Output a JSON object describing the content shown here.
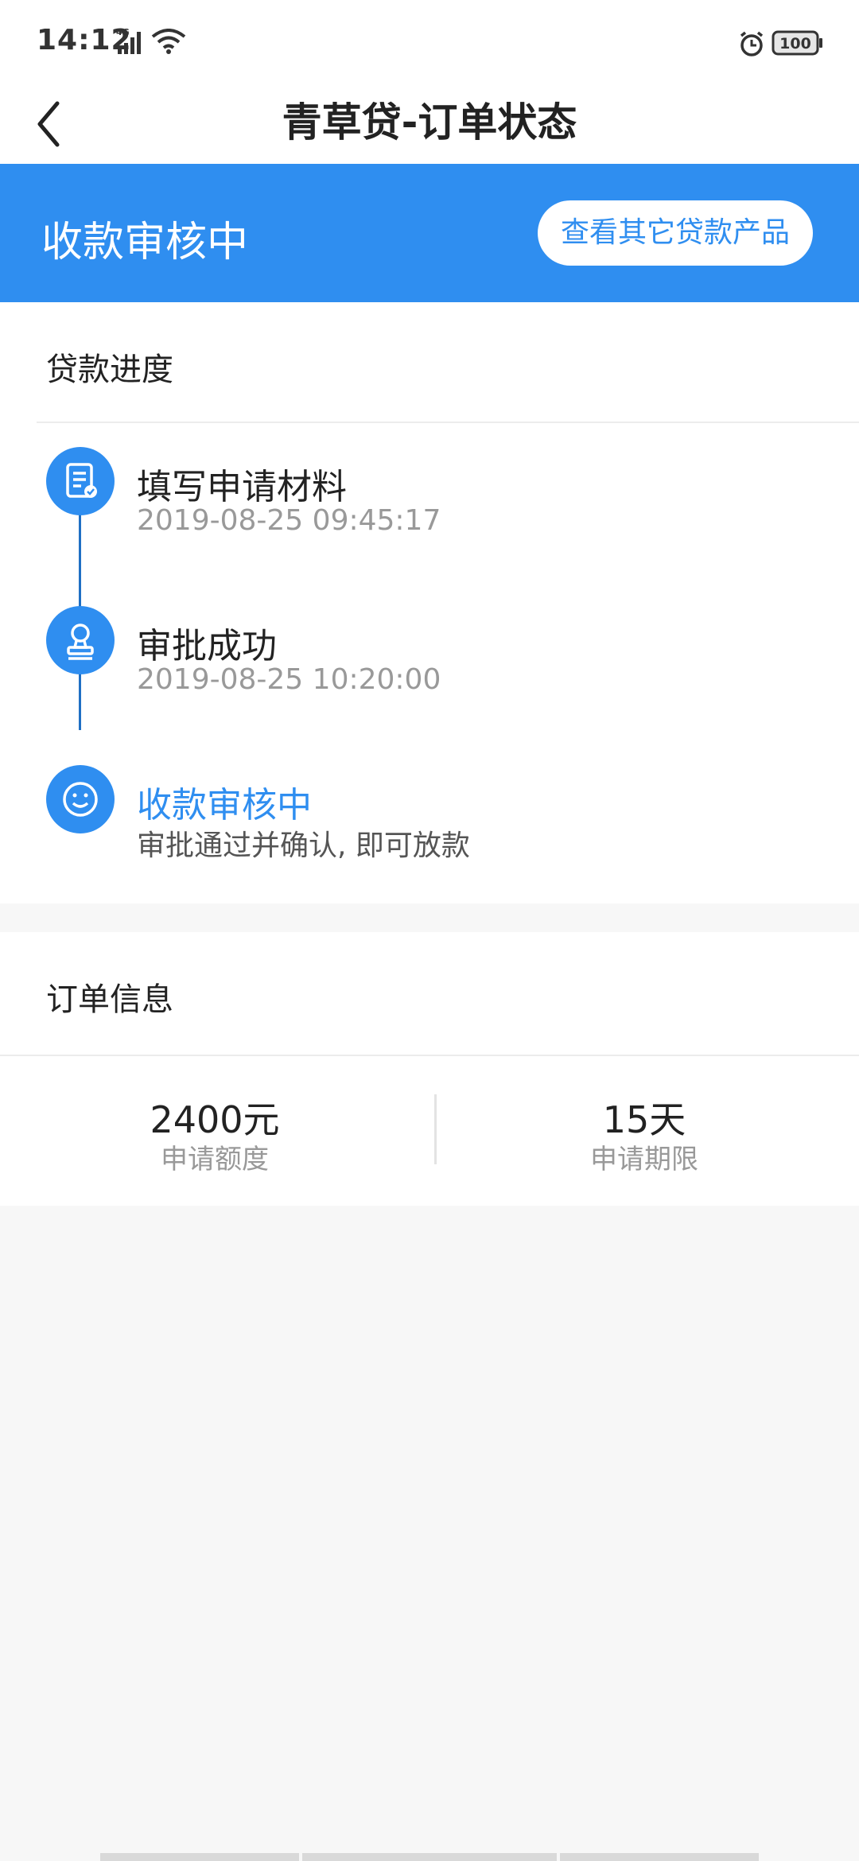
{
  "status_bar": {
    "time": "14:12",
    "network": "4G",
    "battery": "100",
    "icons": [
      "signal-icon",
      "wifi-icon",
      "alarm-icon",
      "battery-icon"
    ]
  },
  "title_bar": {
    "back_icon": "chevron-left-icon",
    "title": "青草贷-订单状态"
  },
  "status_header": {
    "title": "收款审核中",
    "button_label": "查看其它贷款产品"
  },
  "progress": {
    "section_title": "贷款进度",
    "steps": [
      {
        "icon": "document-check-icon",
        "title": "填写申请材料",
        "sub": "2019-08-25 09:45:17"
      },
      {
        "icon": "stamp-icon",
        "title": "审批成功",
        "sub": "2019-08-25 10:20:00"
      },
      {
        "icon": "smiley-icon",
        "title": "收款审核中",
        "sub": "审批通过并确认, 即可放款"
      }
    ]
  },
  "order_info": {
    "section_title": "订单信息",
    "amount_value": "2400元",
    "amount_label": "申请额度",
    "term_value": "15天",
    "term_label": "申请期限"
  },
  "colors": {
    "accent": "#2f8ef0",
    "timeline": "#1f6fc4",
    "background": "#f7f7f7"
  }
}
